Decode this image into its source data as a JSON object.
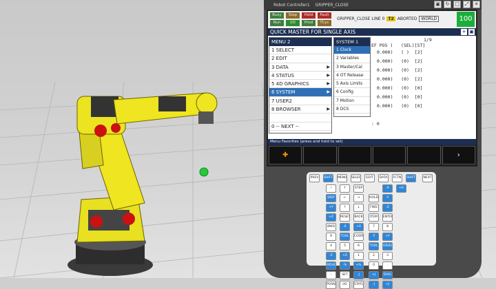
{
  "window": {
    "controller": "Robot Controller1",
    "program": "GRIPPER_CLOSE"
  },
  "status": {
    "lamps": [
      {
        "label": "Busy",
        "color": "#3f7d3f"
      },
      {
        "label": "Step",
        "color": "#8c6a2a"
      },
      {
        "label": "Hold",
        "color": "#b02a2a"
      },
      {
        "label": "Fault",
        "color": "#b02a2a"
      },
      {
        "label": "Run",
        "color": "#3f7d3f"
      },
      {
        "label": "I/O",
        "color": "#2c8c2c"
      },
      {
        "label": "Prod",
        "color": "#3f7d3f"
      },
      {
        "label": "TCyc",
        "color": "#8c6a2a"
      }
    ],
    "program_line": "GRIPPER_CLOSE LINE 0",
    "t2": "T2",
    "state": "ABORTED",
    "frame": "WORLD",
    "override": "100"
  },
  "screen": {
    "title": "QUICK MASTER FOR SINGLE AXIS",
    "page": "1/9",
    "header_text": "EF POS )   (SEL)[ST]",
    "rows": [
      "0.000)   ( )  [2]",
      "0.000)   (0)  [2]",
      "0.000)   (0)  [2]",
      "0.000)   (0)  [2]",
      "0.000)   (0)  [0]",
      "0.000)   (0)  [0]",
      "0.000)   (0)  [0]"
    ],
    "trailing": ": 0",
    "favorites_bar": "Menu Favorites (press and hold to set)",
    "fkey_next": "›"
  },
  "menu": {
    "title": "MENU  2",
    "items": [
      {
        "label": "1 SELECT",
        "has_sub": false
      },
      {
        "label": "2 EDIT",
        "has_sub": false
      },
      {
        "label": "3 DATA",
        "has_sub": true
      },
      {
        "label": "4 STATUS",
        "has_sub": true
      },
      {
        "label": "5 4D GRAPHICS",
        "has_sub": true
      },
      {
        "label": "6 SYSTEM",
        "has_sub": true
      },
      {
        "label": "7 USER2",
        "has_sub": false
      },
      {
        "label": "8 BROWSER",
        "has_sub": true
      },
      {
        "label": "",
        "has_sub": false
      },
      {
        "label": "0 -- NEXT --",
        "has_sub": false
      }
    ],
    "selected_index": 5
  },
  "submenu": {
    "title": "SYSTEM  1",
    "items": [
      "1 Clock",
      "2 Variables",
      "3 Master/Cal",
      "4 OT Release",
      "5 Axis Limits",
      "6 Config",
      "7 Motion",
      "8 DCS"
    ],
    "selected_index": 0
  },
  "keypad": {
    "keys": [
      {
        "label": "PREV",
        "style": "normal"
      },
      {
        "label": "SHIFT",
        "style": "blue"
      },
      {
        "label": "MENU",
        "style": "normal"
      },
      {
        "label": "SELECT",
        "style": "normal"
      },
      {
        "label": "EDIT",
        "style": "normal"
      },
      {
        "label": "DATA",
        "style": "normal"
      },
      {
        "label": "FCTN",
        "style": "normal"
      },
      {
        "label": "SHIFT",
        "style": "blue"
      },
      {
        "label": "NEXT",
        "style": "normal"
      },
      {
        "label": "i",
        "style": "normal"
      },
      {
        "label": "↑",
        "style": "normal"
      },
      {
        "label": "STEP",
        "style": "normal"
      },
      {
        "label": "-X",
        "style": "blue"
      },
      {
        "label": "+X",
        "style": "blue"
      },
      {
        "label": "DISP",
        "style": "blue"
      },
      {
        "label": "←",
        "style": "normal"
      },
      {
        "label": "→",
        "style": "normal"
      },
      {
        "label": "HOLD",
        "style": "normal"
      },
      {
        "label": "-Y",
        "style": "blue"
      },
      {
        "label": "+Y",
        "style": "blue"
      },
      {
        "label": "?",
        "style": "normal"
      },
      {
        "label": "↓",
        "style": "normal"
      },
      {
        "label": "FWD",
        "style": "normal"
      },
      {
        "label": "-Z",
        "style": "blue"
      },
      {
        "label": "+Z",
        "style": "blue"
      },
      {
        "label": "RESET",
        "style": "normal"
      },
      {
        "label": "BACK SPACE",
        "style": "normal"
      },
      {
        "label": "ITEM",
        "style": "normal"
      },
      {
        "label": "ENTER",
        "style": "normal"
      },
      {
        "label": "BWD",
        "style": "normal"
      },
      {
        "label": "-X",
        "style": "blue"
      },
      {
        "label": "+X",
        "style": "blue"
      },
      {
        "label": "7",
        "style": "normal"
      },
      {
        "label": "8",
        "style": "normal"
      },
      {
        "label": "9",
        "style": "normal"
      },
      {
        "label": "TOOL 1",
        "style": "blue"
      },
      {
        "label": "COORD",
        "style": "normal"
      },
      {
        "label": "-Y",
        "style": "blue"
      },
      {
        "label": "+Y",
        "style": "blue"
      },
      {
        "label": "4",
        "style": "normal"
      },
      {
        "label": "5",
        "style": "normal"
      },
      {
        "label": "6",
        "style": "normal"
      },
      {
        "label": "TOOL 2",
        "style": "blue"
      },
      {
        "label": "GROUP",
        "style": "blue"
      },
      {
        "label": "-Z",
        "style": "blue"
      },
      {
        "label": "+Z",
        "style": "blue"
      },
      {
        "label": "1",
        "style": "normal"
      },
      {
        "label": "2",
        "style": "normal"
      },
      {
        "label": "3",
        "style": "normal"
      },
      {
        "label": "MOVE MENU",
        "style": "blue"
      },
      {
        "label": "-%",
        "style": "blue"
      },
      {
        "label": "+%",
        "style": "blue"
      },
      {
        "label": "0",
        "style": "normal"
      },
      {
        "label": ".",
        "style": "normal"
      },
      {
        "label": "-",
        "style": "normal"
      },
      {
        "label": "SET UP",
        "style": "normal"
      },
      {
        "label": "-J",
        "style": "blue"
      },
      {
        "label": "+J",
        "style": "blue"
      },
      {
        "label": "DIAG HELP",
        "style": "blue"
      },
      {
        "label": "POSN",
        "style": "normal"
      },
      {
        "label": "I/O",
        "style": "normal"
      },
      {
        "label": "STATUS",
        "style": "normal"
      },
      {
        "label": "-J",
        "style": "blue"
      },
      {
        "label": "+J",
        "style": "blue"
      }
    ],
    "posn_side": "POSN"
  }
}
